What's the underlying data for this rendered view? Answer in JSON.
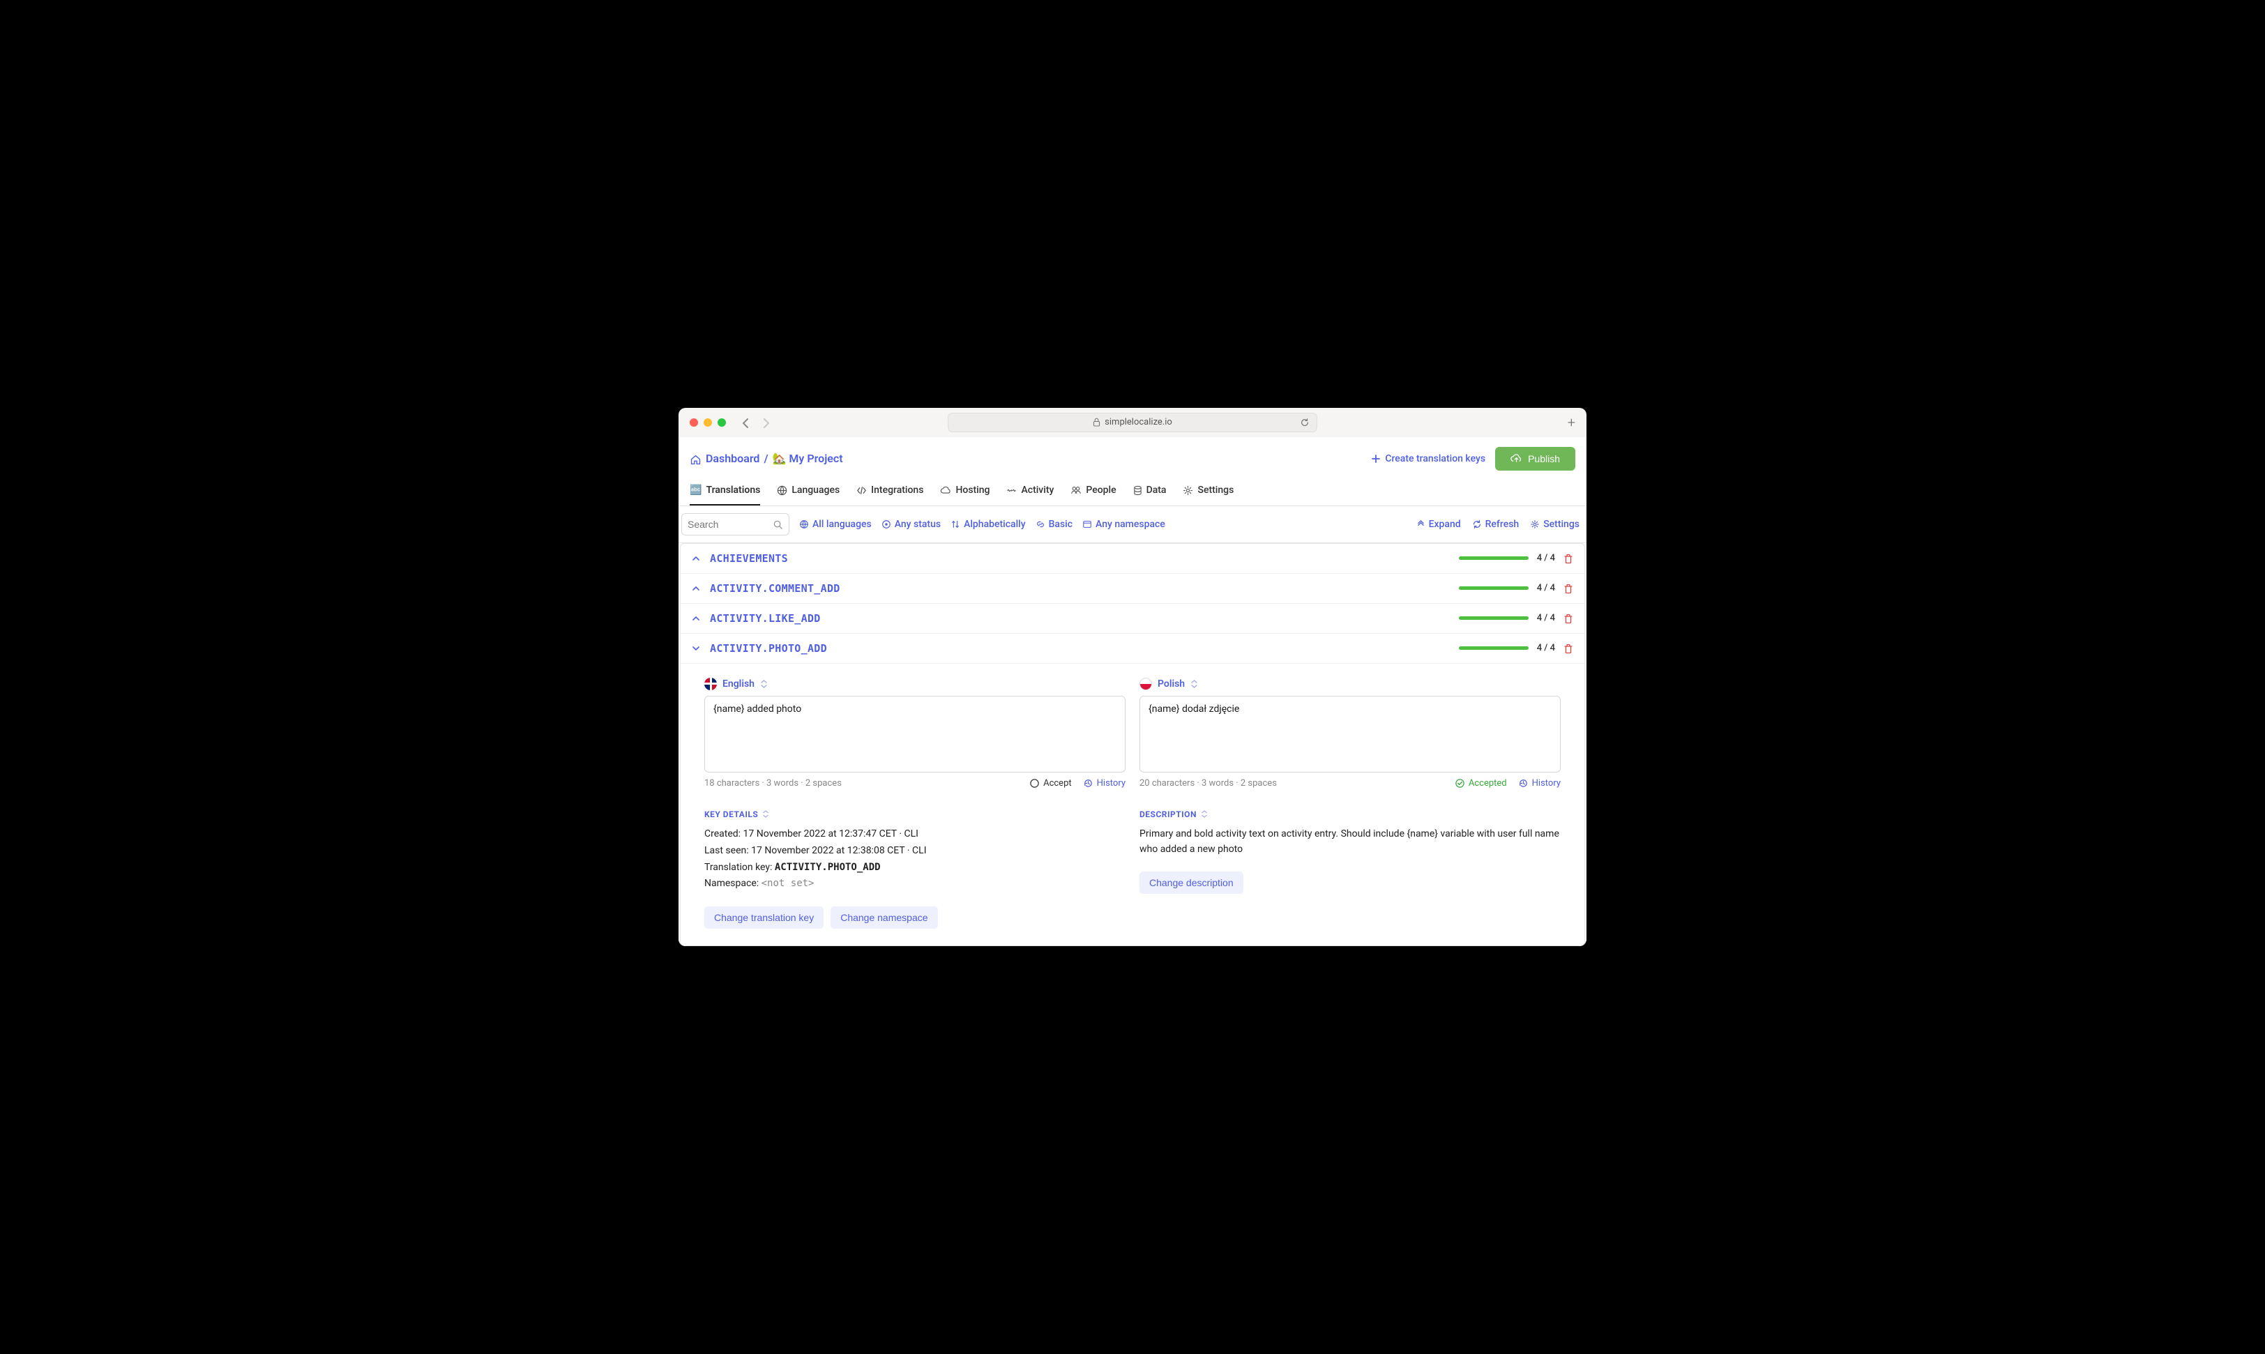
{
  "browser": {
    "url": "simplelocalize.io"
  },
  "breadcrumb": {
    "dashboard": "Dashboard",
    "project": "🏡 My Project"
  },
  "header_actions": {
    "create_keys": "Create translation keys",
    "publish": "Publish"
  },
  "tabs": {
    "translations": "Translations",
    "languages": "Languages",
    "integrations": "Integrations",
    "hosting": "Hosting",
    "activity": "Activity",
    "people": "People",
    "data": "Data",
    "settings": "Settings"
  },
  "toolbar": {
    "search_placeholder": "Search",
    "all_languages": "All languages",
    "any_status": "Any status",
    "alphabetically": "Alphabetically",
    "basic": "Basic",
    "any_namespace": "Any namespace",
    "expand": "Expand",
    "refresh": "Refresh",
    "settings": "Settings"
  },
  "keys": [
    {
      "name": "ACHIEVEMENTS",
      "count": "4 / 4",
      "expanded": false
    },
    {
      "name": "ACTIVITY.COMMENT_ADD",
      "count": "4 / 4",
      "expanded": false
    },
    {
      "name": "ACTIVITY.LIKE_ADD",
      "count": "4 / 4",
      "expanded": false
    },
    {
      "name": "ACTIVITY.PHOTO_ADD",
      "count": "4 / 4",
      "expanded": true
    }
  ],
  "editor": {
    "english": {
      "lang": "English",
      "text": "{name} added photo",
      "stats": "18 characters  ·  3 words  ·  2 spaces",
      "accept": "Accept",
      "history": "History"
    },
    "polish": {
      "lang": "Polish",
      "text": "{name} dodał zdjęcie",
      "stats": "20 characters  ·  3 words  ·  2 spaces",
      "accepted": "Accepted",
      "history": "History"
    }
  },
  "key_details": {
    "label": "Key Details",
    "created_label": "Created: ",
    "created": "17 November 2022 at 12:37:47 CET  ·  CLI",
    "lastseen_label": "Last seen: ",
    "lastseen": "17 November 2022 at 12:38:08 CET  ·  CLI",
    "tkey_label": "Translation key: ",
    "tkey": "ACTIVITY.PHOTO_ADD",
    "ns_label": "Namespace: ",
    "ns": "<not set>",
    "change_key": "Change translation key",
    "change_ns": "Change namespace"
  },
  "description": {
    "label": "Description",
    "text": "Primary and bold activity text on activity entry. Should include {name} variable with user full name who added a new photo",
    "change": "Change description"
  }
}
